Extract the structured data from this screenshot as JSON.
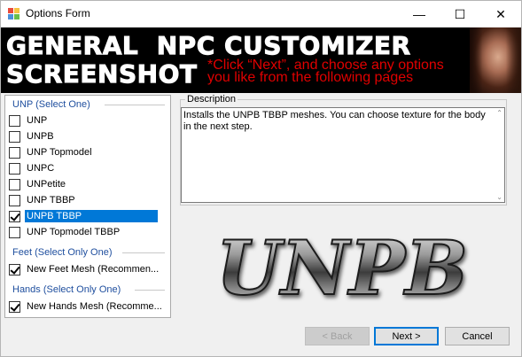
{
  "window": {
    "title": "Options Form",
    "minimize_glyph": "—",
    "maximize_glyph": "☐",
    "close_glyph": "✕"
  },
  "banner": {
    "line1": "GENERAL  NPC CUSTOMIZER",
    "line2": "SCREENSHOT",
    "hint_line1": "*Click “Next”, and choose any options",
    "hint_line2": "you like from the following pages"
  },
  "groups": [
    {
      "header": "UNP (Select One)",
      "options": [
        {
          "label": "UNP",
          "checked": false,
          "selected": false
        },
        {
          "label": "UNPB",
          "checked": false,
          "selected": false
        },
        {
          "label": "UNP Topmodel",
          "checked": false,
          "selected": false
        },
        {
          "label": "UNPC",
          "checked": false,
          "selected": false
        },
        {
          "label": "UNPetite",
          "checked": false,
          "selected": false
        },
        {
          "label": "UNP TBBP",
          "checked": false,
          "selected": false
        },
        {
          "label": "UNPB TBBP",
          "checked": true,
          "selected": true
        },
        {
          "label": "UNP Topmodel TBBP",
          "checked": false,
          "selected": false
        }
      ]
    },
    {
      "header": "Feet (Select Only One)",
      "options": [
        {
          "label": "New Feet Mesh (Recommen...",
          "checked": true,
          "selected": false
        }
      ]
    },
    {
      "header": "Hands (Select Only One)",
      "options": [
        {
          "label": "New Hands Mesh (Recomme...",
          "checked": true,
          "selected": false
        }
      ]
    }
  ],
  "description": {
    "label": "Description",
    "text": "Installs the UNPB TBBP meshes. You can choose texture for the body in the next step."
  },
  "preview": {
    "text": "UNPB"
  },
  "buttons": {
    "back": "< Back",
    "next": "Next >",
    "cancel": "Cancel"
  },
  "colors": {
    "accent": "#0078d7",
    "group_header": "#1e4e9e",
    "banner_hint": "#e00000"
  },
  "icons": {
    "app": "options-form-app-icon",
    "scroll_up": "scroll-up-arrow-icon",
    "scroll_down": "scroll-down-arrow-icon"
  }
}
